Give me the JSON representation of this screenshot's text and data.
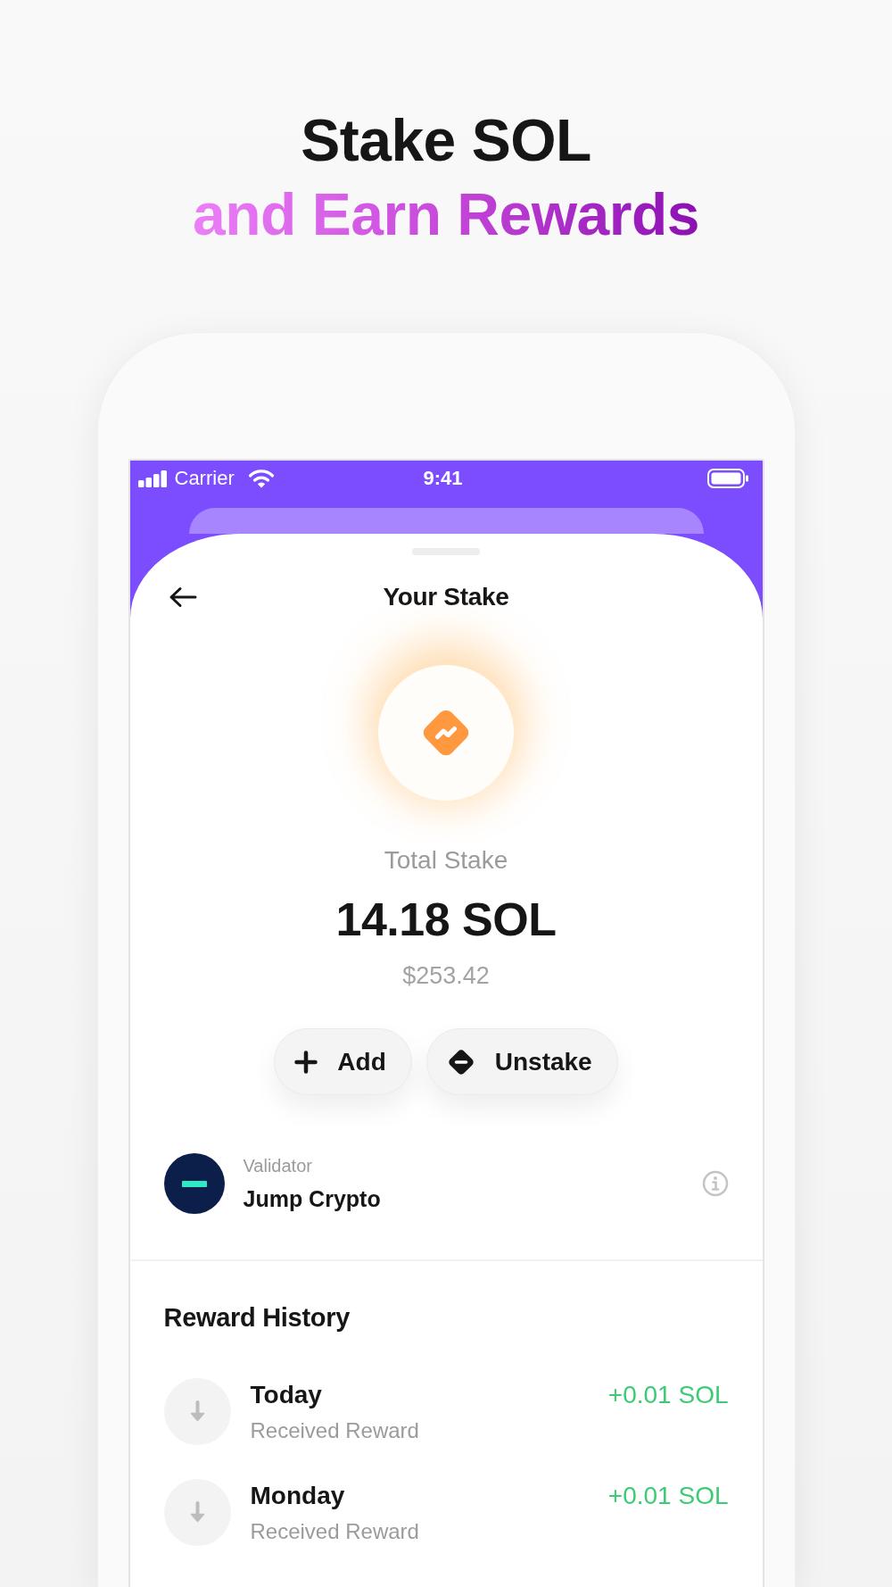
{
  "headline": {
    "title": "Stake SOL",
    "subtitle": "and Earn Rewards"
  },
  "status_bar": {
    "carrier": "Carrier",
    "time": "9:41"
  },
  "header": {
    "title": "Your Stake"
  },
  "stake": {
    "label": "Total Stake",
    "amount": "14.18 SOL",
    "value": "$253.42"
  },
  "actions": [
    {
      "kind": "add",
      "label": "Add"
    },
    {
      "kind": "unstake",
      "label": "Unstake"
    }
  ],
  "validator": {
    "label": "Validator",
    "name": "Jump Crypto"
  },
  "reward_history": {
    "title": "Reward History",
    "rows": [
      {
        "day": "Today",
        "description": "Received Reward",
        "amount": "+0.01 SOL"
      },
      {
        "day": "Monday",
        "description": "Received Reward",
        "amount": "+0.01 SOL"
      }
    ]
  }
}
